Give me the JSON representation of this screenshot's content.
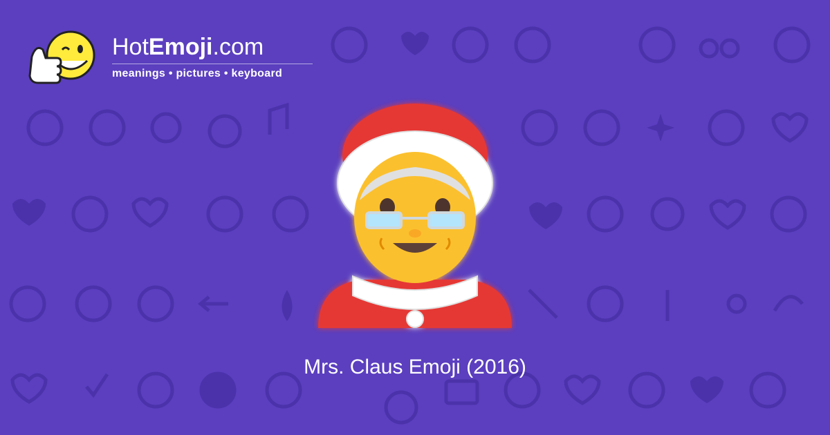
{
  "logo": {
    "brand_prefix": "Hot",
    "brand_bold": "Emoji",
    "brand_suffix": ".com",
    "tagline": "meanings • pictures • keyboard"
  },
  "caption": "Mrs. Claus Emoji (2016)",
  "colors": {
    "background": "#5b3fbf",
    "pattern": "#4d33ad",
    "hat_red": "#e53935",
    "fur_white": "#ffffff",
    "skin": "#fbc02d"
  },
  "icons": {
    "logo": "thumbs-up-wink-icon",
    "main": "mrs-claus-icon"
  }
}
